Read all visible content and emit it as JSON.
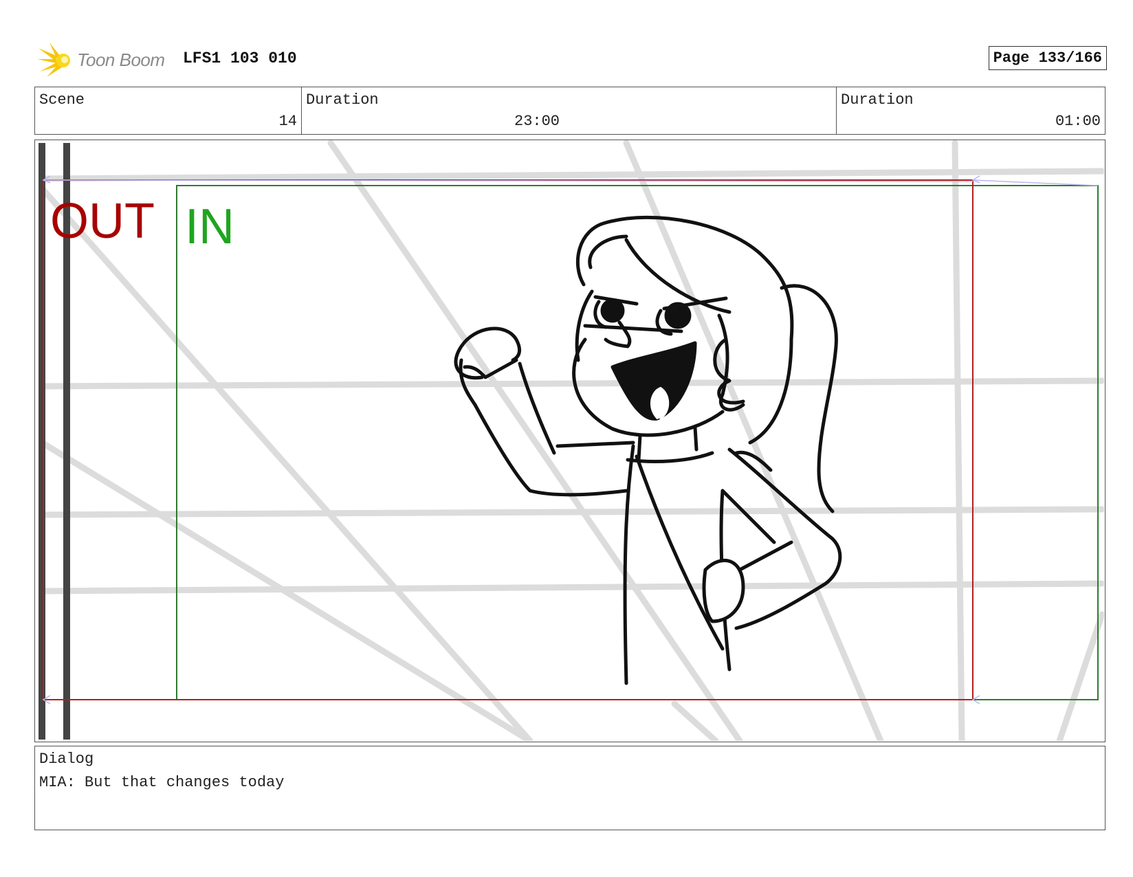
{
  "header": {
    "logo_text": "Toon Boom",
    "project": "LFS1 103 010",
    "page": "Page 133/166"
  },
  "info": {
    "scene_label": "Scene",
    "scene_value": "14",
    "duration_label": "Duration",
    "duration_value": "23:00",
    "duration2_label": "Duration",
    "duration2_value": "01:00"
  },
  "panel": {
    "out_label": "OUT",
    "in_label": "IN",
    "colors": {
      "out": "#a80000",
      "in": "#1fa51f",
      "in_frame": "#2e7a2e",
      "guides": "#d9d9d9"
    },
    "subject": "character-sketch"
  },
  "dialog": {
    "label": "Dialog",
    "text": "MIA: But that changes today"
  }
}
